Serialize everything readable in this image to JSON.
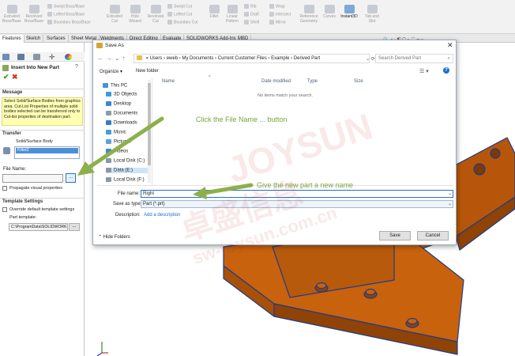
{
  "ribbon": {
    "big": [
      {
        "label": "Extruded\nBoss/Base"
      },
      {
        "label": "Revolved\nBoss/Base"
      },
      {
        "label": "Extruded\nCut"
      },
      {
        "label": "Hole\nWizard"
      },
      {
        "label": "Revolved\nCut"
      },
      {
        "label": "Fillet"
      },
      {
        "label": "Linear\nPattern"
      },
      {
        "label": "Reference\nGeometry"
      },
      {
        "label": "Curves"
      },
      {
        "label": "Instant3D"
      },
      {
        "label": "Tab and\nSlot"
      }
    ],
    "small": [
      "Swept Boss/Base",
      "Lofted Boss/Base",
      "Boundary Boss/Base",
      "Swept Cut",
      "Lofted Cut",
      "Boundary Cut",
      "Rib",
      "Draft",
      "Shell",
      "Wrap",
      "Intersect",
      "Mirror"
    ],
    "tabs": [
      "Features",
      "Sketch",
      "Surfaces",
      "Sheet Metal",
      "Weldments",
      "Direct Editing",
      "Evaluate",
      "SOLIDWORKS Add-Ins",
      "MBD"
    ]
  },
  "pm": {
    "title": "Insert Into New Part",
    "message_header": "Message",
    "message_text": "Select Solid/Surface Bodies from graphics area. Cut-List Properties of multiple solid bodies selected can be transferred only to Cut-list properties of destination part.",
    "transfer_header": "Transfer",
    "body_label": "Solid/Surface Body",
    "body_item": "Fillet2",
    "file_name_label": "File Name:",
    "browse_label": "...",
    "propagate_label": "Propagate visual properties",
    "template_header": "Template Settings",
    "override_label": "Override default template settings",
    "part_template_label": "Part template:",
    "part_template_value": "C:\\ProgramData\\SOLIDWORK",
    "template_browse": "..."
  },
  "dialog": {
    "title": "Save As",
    "breadcrumb": [
      "«  Users",
      "eweb",
      "My Documents",
      "Current Customer Files",
      "Example",
      "Derived Part"
    ],
    "search_placeholder": "Search Derived Part",
    "organize": "Organize ▾",
    "new_folder": "New folder",
    "nav": [
      "This PC",
      "3D Objects",
      "Desktop",
      "Documents",
      "Downloads",
      "Music",
      "Pictures",
      "Videos",
      "Local Disk (C:)",
      "Data (E:)",
      "Local Disk (F:)"
    ],
    "columns": [
      "Name",
      "Date modified",
      "Type",
      "Size"
    ],
    "empty_text": "No items match your search.",
    "file_name_label": "File name:",
    "file_name_value": "Right",
    "save_type_label": "Save as type:",
    "save_type_value": "Part (*.prt)",
    "description_label": "Description:",
    "description_link": "Add a description",
    "hide_folders": "Hide Folders",
    "save_button": "Save",
    "cancel_button": "Cancel"
  },
  "annotations": {
    "click_file_name": "Click the File Name ... button",
    "give_name": "Give the new part a new name"
  },
  "watermark": {
    "brand": "JOYSUN",
    "site": "sw-joysun.com.cn",
    "cn": "卓盛信息"
  },
  "colors": {
    "accent": "#0078d7",
    "part": "#c8620d",
    "edge": "#1c3c8c",
    "annot": "#7aa33a",
    "msg": "#ffffb4"
  }
}
